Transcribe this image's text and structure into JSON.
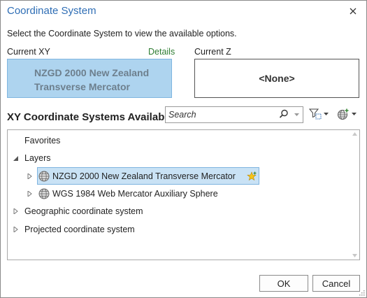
{
  "dialog": {
    "title": "Coordinate System",
    "intro": "Select the Coordinate System to view the available options."
  },
  "current": {
    "xy_label": "Current XY",
    "details_label": "Details",
    "xy_value_line1": "NZGD 2000 New Zealand",
    "xy_value_line2": "Transverse Mercator",
    "z_label": "Current Z",
    "z_value": "<None>"
  },
  "available": {
    "heading": "XY Coordinate Systems Available",
    "search_placeholder": "Search"
  },
  "tree": {
    "favorites": "Favorites",
    "layers": "Layers",
    "layer_items": [
      "NZGD 2000 New Zealand Transverse Mercator",
      "WGS 1984 Web Mercator Auxiliary Sphere"
    ],
    "geographic": "Geographic coordinate system",
    "projected": "Projected coordinate system"
  },
  "buttons": {
    "ok": "OK",
    "cancel": "Cancel"
  },
  "colors": {
    "title": "#2f6eb5",
    "details": "#2e7d32",
    "selection": "#c9e2f5",
    "current_xy_fill": "#aed4ef"
  },
  "icons": {
    "close": "close-icon",
    "search": "search-icon",
    "filter": "filter-icon",
    "add_coordinate_system": "globe-add-icon",
    "globe": "globe-icon",
    "favorite": "star-add-icon"
  }
}
